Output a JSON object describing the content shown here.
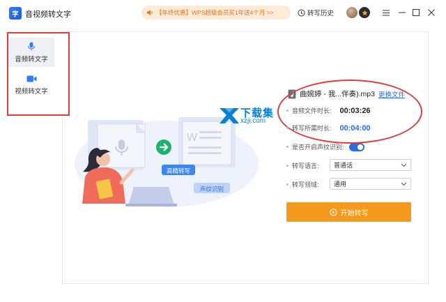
{
  "app": {
    "logo_text": "字",
    "title": "音视频转文字"
  },
  "promo": {
    "text": "【年终优惠】WPS超级会员买1年送4个月 >>"
  },
  "header": {
    "history_label": "转写历史"
  },
  "sidebar": {
    "items": [
      {
        "label": "音频转文字",
        "icon": "microphone-icon",
        "active": true
      },
      {
        "label": "视频转文字",
        "icon": "video-camera-icon",
        "active": false
      }
    ]
  },
  "illustration": {
    "tag_accurate": "高精转写",
    "tag_voiceprint": "声纹识别"
  },
  "watermark": {
    "line1": "下载集",
    "line2": "xzji.com"
  },
  "file": {
    "name": "曲婉婷 - 我...伴奏).mp3",
    "change_label": "更换文件"
  },
  "form": {
    "duration_label": "音频文件时长:",
    "duration_value": "00:03:26",
    "time_needed_label": "转写所需时长:",
    "time_needed_value": "00:04:00",
    "voiceprint_label": "是否开启声纹识别:",
    "voiceprint_enabled": true,
    "language_label": "转写语言:",
    "language_value": "普通话",
    "domain_label": "转写领域:",
    "domain_value": "通用",
    "start_button": "开始转写"
  },
  "corner_text": "",
  "colors": {
    "accent_blue": "#2f6bdc",
    "start_orange": "#f39a1e",
    "annotation_red": "#e03c3c"
  }
}
